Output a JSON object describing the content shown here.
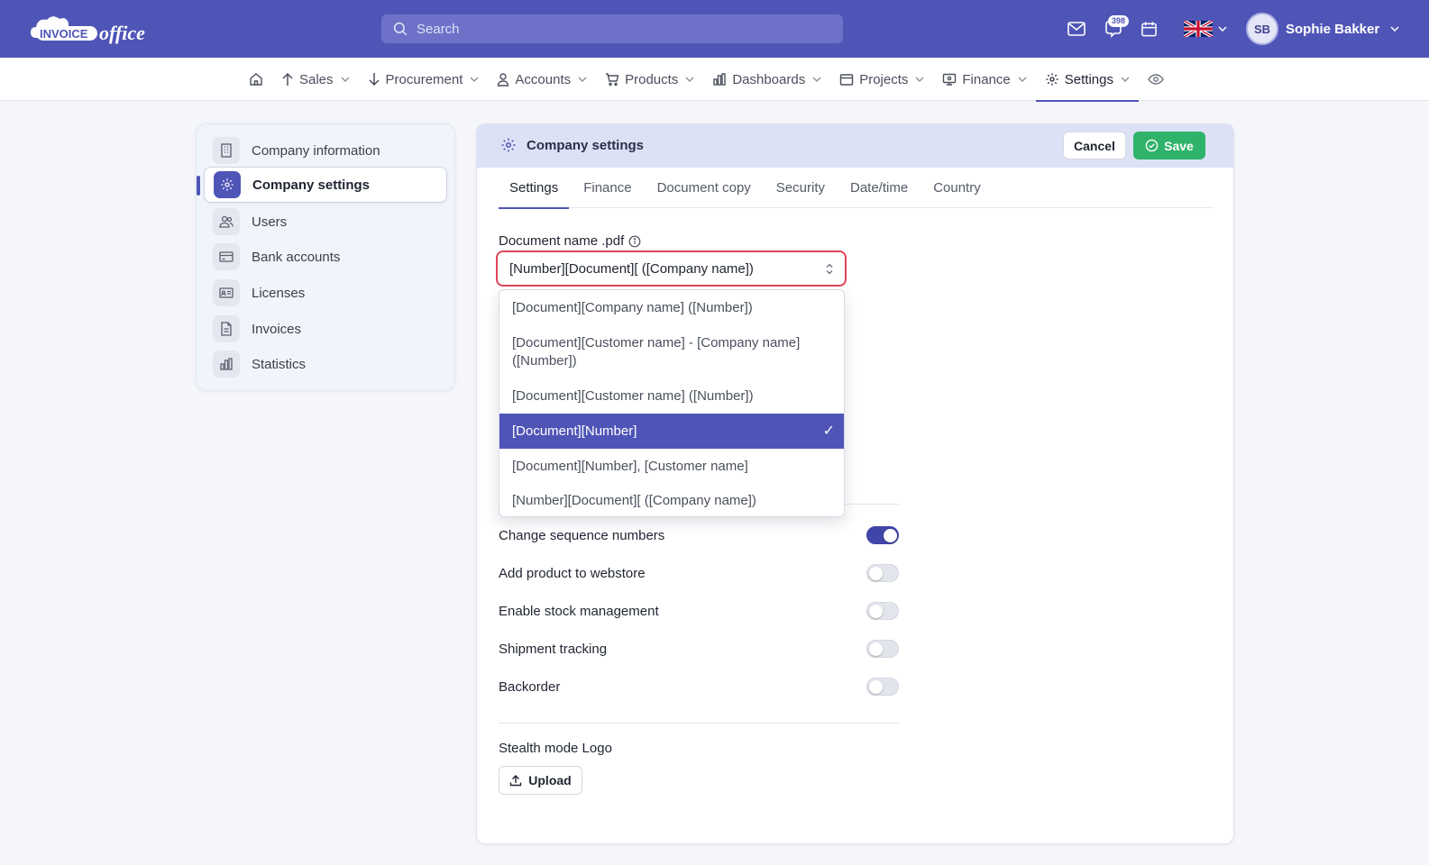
{
  "header": {
    "logo_text_1": "INVOICE",
    "logo_text_2": "office",
    "search_placeholder": "Search",
    "notification_count": "398",
    "language_flag": "uk-flag-icon",
    "user_initials": "SB",
    "user_name": "Sophie Bakker",
    "brand_color": "#4f55b7"
  },
  "nav": {
    "home_icon": "home-icon",
    "items": [
      {
        "label": "Sales",
        "icon": "arrow-up-icon"
      },
      {
        "label": "Procurement",
        "icon": "arrow-down-icon"
      },
      {
        "label": "Accounts",
        "icon": "user-icon"
      },
      {
        "label": "Products",
        "icon": "cart-icon"
      },
      {
        "label": "Dashboards",
        "icon": "bar-chart-icon"
      },
      {
        "label": "Projects",
        "icon": "calendar-icon"
      },
      {
        "label": "Finance",
        "icon": "monitor-icon"
      },
      {
        "label": "Settings",
        "icon": "gear-icon",
        "active": true
      }
    ],
    "eye_icon": "eye-icon"
  },
  "sidebar": {
    "items": [
      {
        "label": "Company information",
        "icon": "building-icon"
      },
      {
        "label": "Company settings",
        "icon": "gear-icon",
        "active": true
      },
      {
        "label": "Users",
        "icon": "users-icon"
      },
      {
        "label": "Bank accounts",
        "icon": "credit-card-icon"
      },
      {
        "label": "Licenses",
        "icon": "id-card-icon"
      },
      {
        "label": "Invoices",
        "icon": "document-icon"
      },
      {
        "label": "Statistics",
        "icon": "bar-chart-icon"
      }
    ]
  },
  "panel": {
    "title": "Company settings",
    "cancel_label": "Cancel",
    "save_label": "Save",
    "tabs": [
      "Settings",
      "Finance",
      "Document copy",
      "Security",
      "Date/time",
      "Country"
    ],
    "active_tab": "Settings",
    "document_name": {
      "label": "Document name .pdf",
      "value": "[Number][Document][ ([Company name])",
      "options": [
        "[Document][Company name] ([Number])",
        "[Document][Customer name] - [Company name] ([Number])",
        "[Document][Customer name] ([Number])",
        "[Document][Number]",
        "[Document][Number], [Customer name]",
        "[Number][Document][ ([Company name])"
      ],
      "highlighted_option": "[Document][Number]",
      "check_mark": "✓"
    },
    "toggles": [
      {
        "label": "Change sequence numbers",
        "on": true
      },
      {
        "label": "Add product to webstore",
        "on": false
      },
      {
        "label": "Enable stock management",
        "on": false
      },
      {
        "label": "Shipment tracking",
        "on": false
      },
      {
        "label": "Backorder",
        "on": false
      }
    ],
    "stealth_logo_label": "Stealth mode Logo",
    "upload_label": "Upload"
  }
}
